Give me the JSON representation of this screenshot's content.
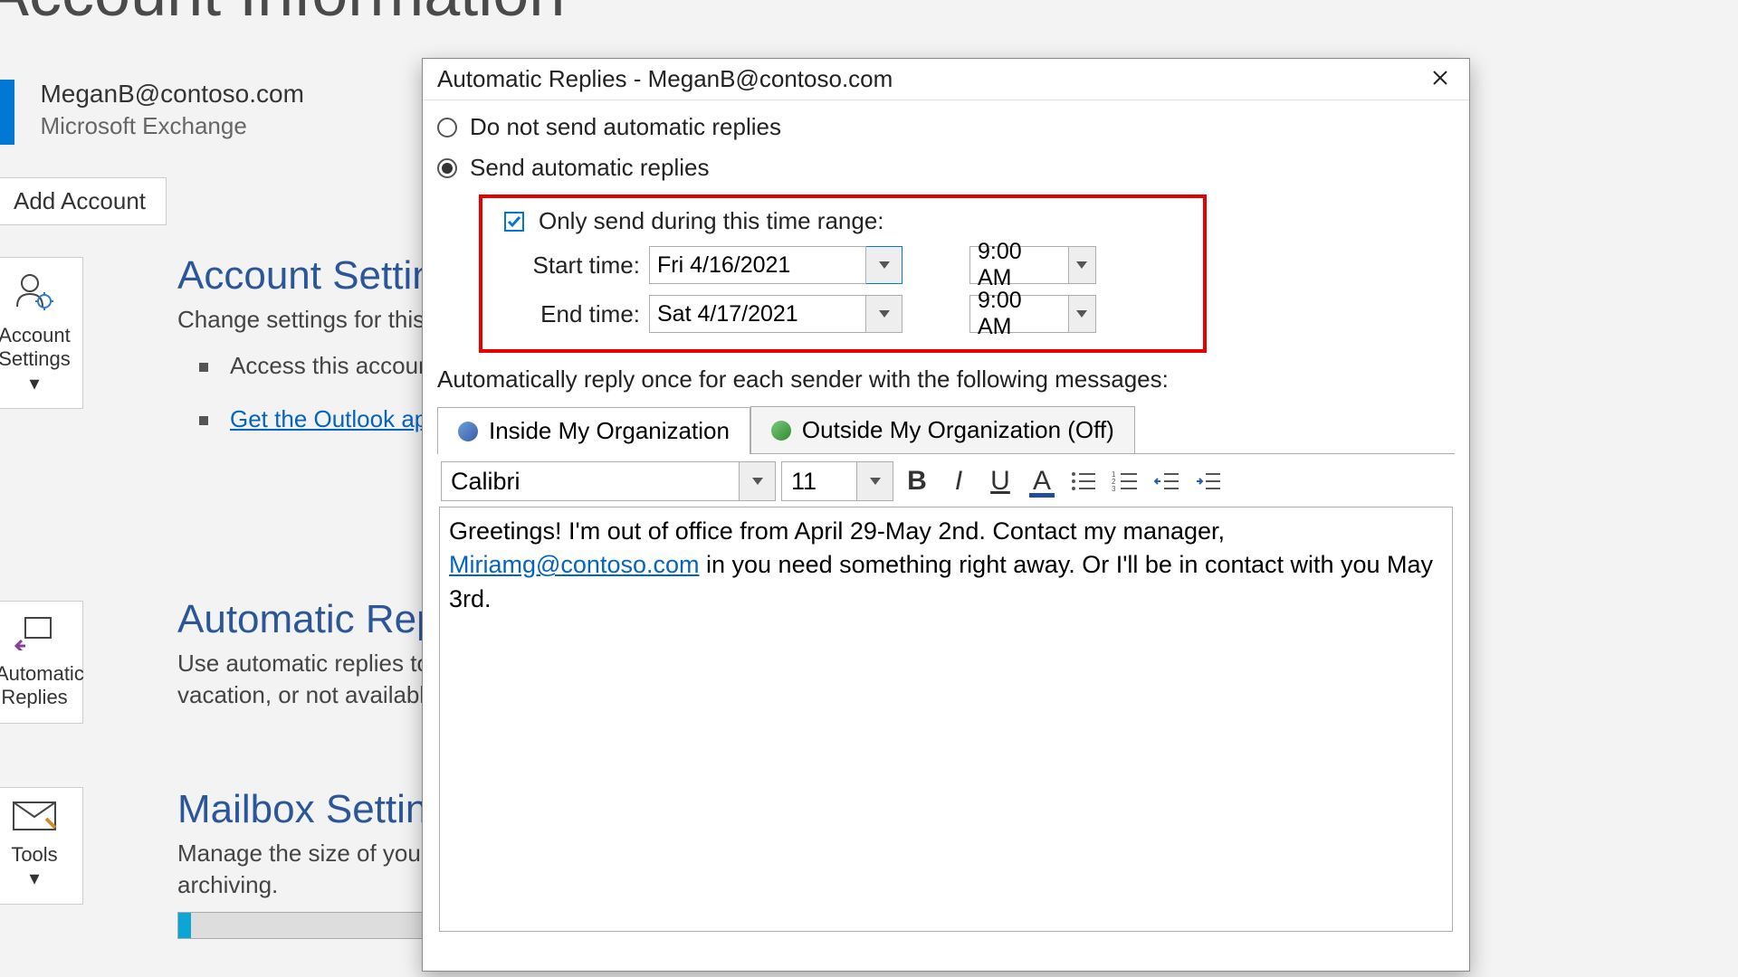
{
  "page": {
    "title": "Account Information"
  },
  "account": {
    "email": "MeganB@contoso.com",
    "type": "Microsoft Exchange",
    "add_button": "Add Account"
  },
  "sidebar": {
    "settings_line1": "Account",
    "settings_line2": "Settings",
    "auto_line1": "Automatic",
    "auto_line2": "Replies",
    "tools_label": "Tools"
  },
  "sections": {
    "acct": {
      "title": "Account Settings",
      "desc": "Change settings for this account or set up more connections.",
      "bullet1": "Access this account",
      "bullet2_link": "Get the Outlook app"
    },
    "auto": {
      "title": "Automatic Replies",
      "desc": "Use automatic replies to notify others that you are out of office, on vacation, or not available to respond to e-mail messages."
    },
    "mbox": {
      "title": "Mailbox Settings",
      "desc": "Manage the size of your mailbox by emptying Deleted Items and archiving."
    }
  },
  "dialog": {
    "title": "Automatic Replies - MeganB@contoso.com",
    "radio_off": "Do not send automatic replies",
    "radio_on": "Send automatic replies",
    "check_range": "Only send during this time range:",
    "start_label": "Start time:",
    "end_label": "End time:",
    "start_date": "Fri 4/16/2021",
    "start_time": "9:00 AM",
    "end_date": "Sat 4/17/2021",
    "end_time": "9:00 AM",
    "info": "Automatically reply once for each sender with the following messages:",
    "tab_inside": "Inside My Organization",
    "tab_outside": "Outside My Organization (Off)",
    "font_name": "Calibri",
    "font_size": "11",
    "msg_part1": "Greetings! I'm out of office from April 29-May 2nd. Contact my manager, ",
    "msg_link": "Miriamg@contoso.com",
    "msg_part2": " in you need something right away. Or I'll be in contact with you May 3rd."
  }
}
